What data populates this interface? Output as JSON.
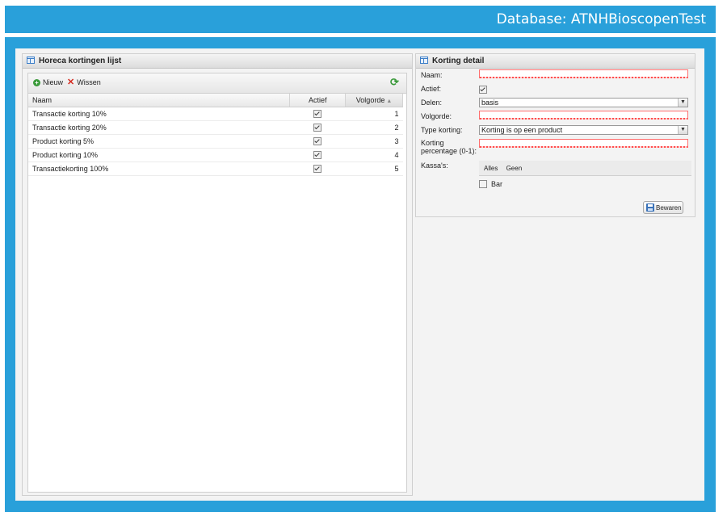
{
  "header": {
    "database_label": "Database: ATNHBioscopenTest"
  },
  "list_panel": {
    "title": "Horeca kortingen lijst",
    "toolbar": {
      "new_label": "Nieuw",
      "delete_label": "Wissen"
    },
    "columns": {
      "naam": "Naam",
      "actief": "Actief",
      "volgorde": "Volgorde"
    },
    "rows": [
      {
        "naam": "Transactie korting 10%",
        "actief": true,
        "volgorde": "1"
      },
      {
        "naam": "Transactie korting 20%",
        "actief": true,
        "volgorde": "2"
      },
      {
        "naam": "Product korting 5%",
        "actief": true,
        "volgorde": "3"
      },
      {
        "naam": "Product korting 10%",
        "actief": true,
        "volgorde": "4"
      },
      {
        "naam": "Transactiekorting 100%",
        "actief": true,
        "volgorde": "5"
      }
    ]
  },
  "detail_panel": {
    "title": "Korting detail",
    "labels": {
      "naam": "Naam:",
      "actief": "Actief:",
      "delen": "Delen:",
      "volgorde": "Volgorde:",
      "type_korting": "Type korting:",
      "korting_pct_1": "Korting",
      "korting_pct_2": "percentage (0-1):",
      "kassas": "Kassa's:"
    },
    "values": {
      "naam": "",
      "actief": true,
      "delen": "basis",
      "volgorde": "",
      "type_korting": "Korting is op een product",
      "korting_pct": ""
    },
    "kassa_links": {
      "all": "Alles",
      "none": "Geen"
    },
    "kassa_items": [
      {
        "label": "Bar",
        "checked": false
      }
    ],
    "save_label": "Bewaren"
  }
}
